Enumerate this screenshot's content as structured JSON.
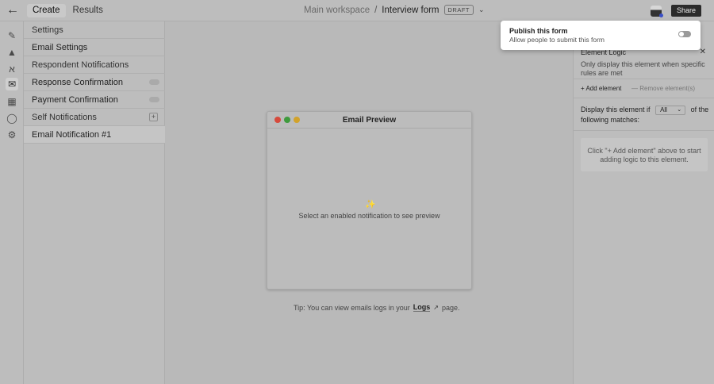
{
  "topbar": {
    "back_icon": "arrow-left-icon",
    "tabs": [
      {
        "label": "Create"
      },
      {
        "label": "Results"
      }
    ],
    "workspace": "Main workspace",
    "separator": "/",
    "form_name": "Interview form",
    "status_badge": "DRAFT",
    "share_label": "Share"
  },
  "rail": {
    "icons": [
      "pencil-icon",
      "stamp-icon",
      "translate-icon",
      "mail-icon",
      "integrations-icon",
      "currency-icon",
      "gear-icon"
    ]
  },
  "sidebar": {
    "settings_label": "Settings",
    "email_settings_label": "Email Settings",
    "respondent_notifications_label": "Respondent Notifications",
    "response_confirmation_label": "Response Confirmation",
    "payment_confirmation_label": "Payment Confirmation",
    "self_notifications_label": "Self Notifications",
    "email_notification_label": "Email Notification #1"
  },
  "preview": {
    "title": "Email Preview",
    "message": "Select an enabled notification to see preview"
  },
  "tip": {
    "prefix": "Tip: You can view emails logs in your",
    "link": "Logs",
    "suffix": "page."
  },
  "right_panel": {
    "title": "Element Logic",
    "description": "Only display this element when specific rules are met",
    "add_label": "Add element",
    "remove_label": "Remove element(s)",
    "condition_prefix": "Display this element if",
    "select_value": "All",
    "condition_suffix": "of the following matches:",
    "empty_text": "Click \"+ Add element\" above to start adding logic to this element."
  },
  "popover": {
    "title": "Publish this form",
    "subtitle": "Allow people to submit this form",
    "toggle_on": false
  }
}
